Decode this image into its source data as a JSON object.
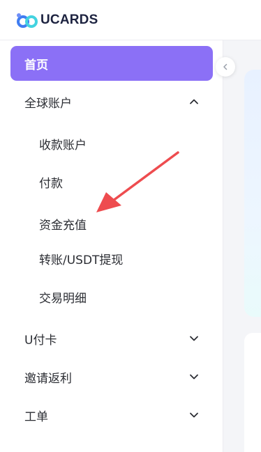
{
  "brand": {
    "name": "UCARDS",
    "logo_icon": "infinity-logo-icon"
  },
  "colors": {
    "accent": "#8b70f6",
    "annotation_arrow": "#ee4c4f",
    "brand_text": "#1d2340",
    "logo_blue": "#3f7df1",
    "logo_cyan": "#43d3e0"
  },
  "sidebar": {
    "home": {
      "label": "首页",
      "active": true
    },
    "groups": [
      {
        "label": "全球账户",
        "expanded": true,
        "icon": "chevron-up-icon",
        "items": [
          {
            "label": "收款账户"
          },
          {
            "label": "付款"
          },
          {
            "label": "资金充值"
          },
          {
            "label": "转账/USDT提现"
          },
          {
            "label": "交易明细"
          }
        ]
      },
      {
        "label": "U付卡",
        "expanded": false,
        "icon": "chevron-down-icon"
      },
      {
        "label": "邀请返利",
        "expanded": false,
        "icon": "chevron-down-icon"
      },
      {
        "label": "工单",
        "expanded": false,
        "icon": "chevron-down-icon"
      }
    ],
    "collapse_icon": "chevron-left-icon"
  },
  "annotation": {
    "type": "arrow",
    "points_to": "资金充值"
  }
}
